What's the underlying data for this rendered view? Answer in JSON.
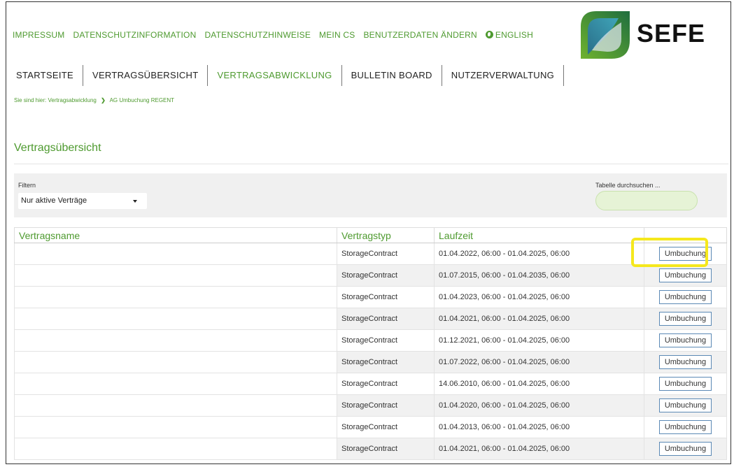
{
  "toplinks": {
    "impressum": "IMPRESSUM",
    "datenschutzinformation": "DATENSCHUTZINFORMATION",
    "datenschutzhinweise": "DATENSCHUTZHINWEISE",
    "mein_cs": "MEIN CS",
    "benutzerdaten": "BENUTZERDATEN ÄNDERN",
    "english": "ENGLISH"
  },
  "logo": {
    "text": "SEFE",
    "icon": "sefe-leaf-logo"
  },
  "nav": {
    "items": [
      {
        "label": "STARTSEITE"
      },
      {
        "label": "VERTRAGSÜBERSICHT"
      },
      {
        "label": "VERTRAGSABWICKLUNG"
      },
      {
        "label": "BULLETIN BOARD"
      },
      {
        "label": "NUTZERVERWALTUNG"
      }
    ]
  },
  "breadcrumb": {
    "lead": "Sie sind hier:",
    "crumb1": "Vertragsabwicklung",
    "crumb2": "AG Umbuchung REGENT"
  },
  "page_title": "Vertragsübersicht",
  "filter": {
    "label": "Filtern",
    "selected": "Nur aktive Verträge",
    "search_label": "Tabelle durchsuchen ..."
  },
  "table": {
    "headers": [
      "Vertragsname",
      "Vertragstyp",
      "Laufzeit",
      ""
    ],
    "rows": [
      {
        "type": "StorageContract",
        "time": "01.04.2022, 06:00 - 01.04.2025, 06:00",
        "action": "Umbuchung"
      },
      {
        "type": "StorageContract",
        "time": "01.07.2015, 06:00 - 01.04.2035, 06:00",
        "action": "Umbuchung"
      },
      {
        "type": "StorageContract",
        "time": "01.04.2023, 06:00 - 01.04.2025, 06:00",
        "action": "Umbuchung"
      },
      {
        "type": "StorageContract",
        "time": "01.04.2021, 06:00 - 01.04.2025, 06:00",
        "action": "Umbuchung"
      },
      {
        "type": "StorageContract",
        "time": "01.12.2021, 06:00 - 01.04.2025, 06:00",
        "action": "Umbuchung"
      },
      {
        "type": "StorageContract",
        "time": "01.07.2022, 06:00 - 01.04.2025, 06:00",
        "action": "Umbuchung"
      },
      {
        "type": "StorageContract",
        "time": "14.06.2010, 06:00 - 01.04.2025, 06:00",
        "action": "Umbuchung"
      },
      {
        "type": "StorageContract",
        "time": "01.04.2020, 06:00 - 01.04.2025, 06:00",
        "action": "Umbuchung"
      },
      {
        "type": "StorageContract",
        "time": "01.04.2013, 06:00 - 01.04.2025, 06:00",
        "action": "Umbuchung"
      },
      {
        "type": "StorageContract",
        "time": "01.04.2021, 06:00 - 01.04.2025, 06:00",
        "action": "Umbuchung"
      }
    ]
  },
  "colors": {
    "brand_green": "#4e9a2f",
    "highlight": "#f5e81d"
  }
}
